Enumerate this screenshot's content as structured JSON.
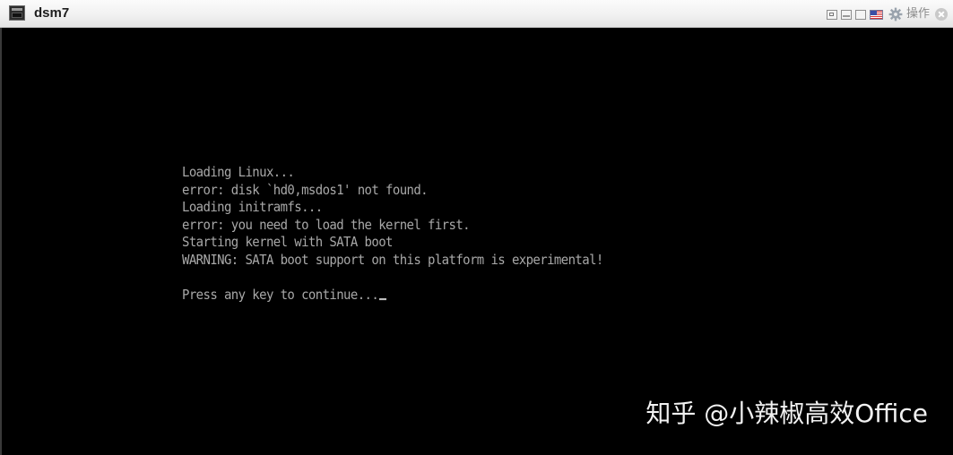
{
  "window": {
    "title": "dsm7",
    "app_icon": "console-icon",
    "controls": {
      "scale_icon": "scale-display-icon",
      "fit_icon": "fit-window-icon",
      "restore_icon": "restore-window-icon",
      "keyboard_layout_icon": "us-flag-icon",
      "gear_icon": "gear-icon",
      "action_label": "操作",
      "close_icon": "close-icon"
    },
    "colors": {
      "titlebar_bg": "#f1f1f1",
      "console_bg": "#000000",
      "console_text": "#a8a8a8"
    }
  },
  "console": {
    "lines": [
      "Loading Linux...",
      "error: disk `hd0,msdos1' not found.",
      "Loading initramfs...",
      "error: you need to load the kernel first.",
      "Starting kernel with SATA boot",
      "WARNING: SATA boot support on this platform is experimental!",
      "",
      "Press any key to continue..."
    ]
  },
  "watermark": {
    "text": "知乎 @小辣椒高效Office"
  }
}
